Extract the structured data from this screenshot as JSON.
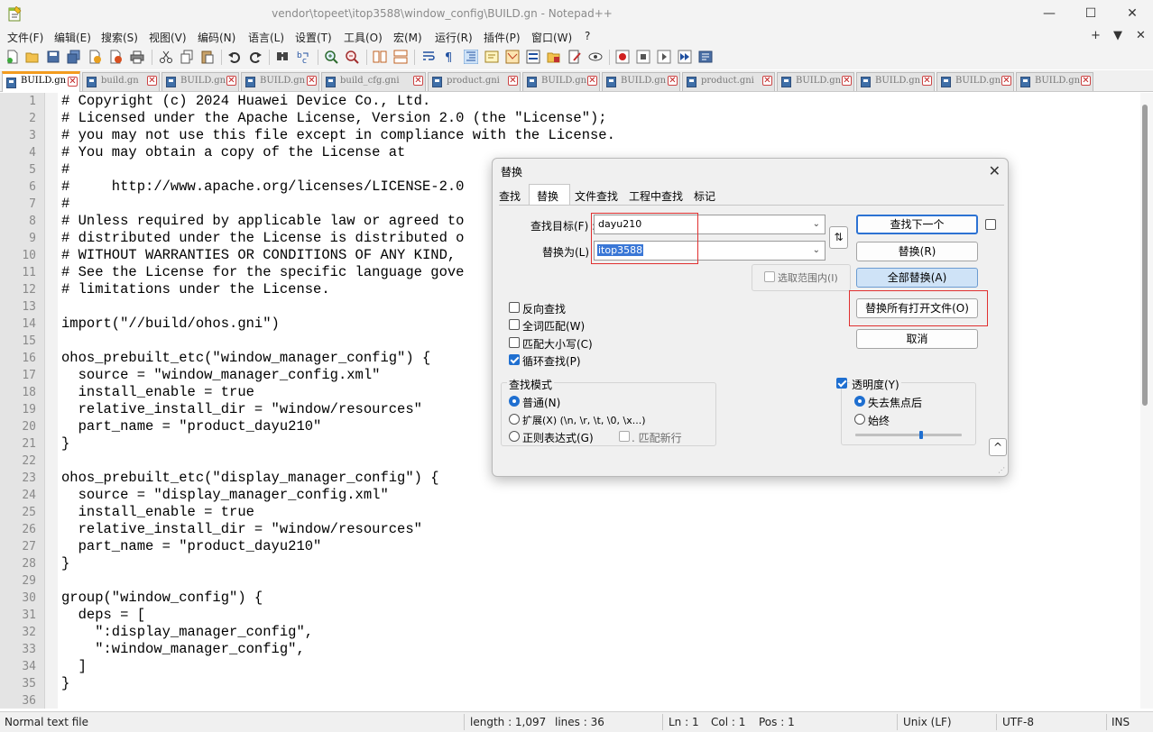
{
  "window": {
    "title": "vendor\\topeet\\itop3588\\window_config\\BUILD.gn - Notepad++",
    "minimize": "—",
    "maximize": "☐",
    "close": "✕"
  },
  "menu": {
    "items": [
      "文件(F)",
      "编辑(E)",
      "搜索(S)",
      "视图(V)",
      "编码(N)",
      "语言(L)",
      "设置(T)",
      "工具(O)",
      "宏(M)",
      "运行(R)",
      "插件(P)",
      "窗口(W)",
      "?"
    ],
    "right": [
      "+",
      "▼",
      "✕"
    ]
  },
  "toolbar": {
    "icons": [
      "new-file-icon",
      "open-file-icon",
      "save-icon",
      "save-all-icon",
      "close-icon",
      "close-all-icon",
      "print-icon",
      "cut-icon",
      "copy-icon",
      "paste-icon",
      "undo-icon",
      "redo-icon",
      "find-icon",
      "replace-icon",
      "zoom-in-icon",
      "zoom-out-icon",
      "sync-vertical-icon",
      "sync-horizontal-icon",
      "word-wrap-icon",
      "show-all-chars-icon",
      "indent-guide-icon",
      "language-icon",
      "doc-map-icon",
      "function-list-icon",
      "folder-workspace-icon",
      "monitor-icon",
      "record-macro-icon",
      "stop-record-icon",
      "play-macro-icon",
      "run-macro-multiple-icon",
      "save-macro-icon"
    ]
  },
  "tabs": [
    {
      "label": "BUILD.gn",
      "active": true
    },
    {
      "label": "build.gn",
      "active": false
    },
    {
      "label": "BUILD.gn",
      "active": false
    },
    {
      "label": "BUILD.gn",
      "active": false
    },
    {
      "label": "build_cfg.gni",
      "active": false
    },
    {
      "label": "product.gni",
      "active": false
    },
    {
      "label": "BUILD.gn",
      "active": false
    },
    {
      "label": "BUILD.gn",
      "active": false
    },
    {
      "label": "product.gni",
      "active": false
    },
    {
      "label": "BUILD.gn",
      "active": false
    },
    {
      "label": "BUILD.gn",
      "active": false
    },
    {
      "label": "BUILD.gn",
      "active": false
    },
    {
      "label": "BUILD.gn",
      "active": false
    }
  ],
  "editor": {
    "lines": [
      "# Copyright (c) 2024 Huawei Device Co., Ltd.",
      "# Licensed under the Apache License, Version 2.0 (the \"License\");",
      "# you may not use this file except in compliance with the License.",
      "# You may obtain a copy of the License at",
      "#",
      "#     http://www.apache.org/licenses/LICENSE-2.0",
      "#",
      "# Unless required by applicable law or agreed to",
      "# distributed under the License is distributed o",
      "# WITHOUT WARRANTIES OR CONDITIONS OF ANY KIND,",
      "# See the License for the specific language gove",
      "# limitations under the License.",
      "",
      "import(\"//build/ohos.gni\")",
      "",
      "ohos_prebuilt_etc(\"window_manager_config\") {",
      "  source = \"window_manager_config.xml\"",
      "  install_enable = true",
      "  relative_install_dir = \"window/resources\"",
      "  part_name = \"product_dayu210\"",
      "}",
      "",
      "ohos_prebuilt_etc(\"display_manager_config\") {",
      "  source = \"display_manager_config.xml\"",
      "  install_enable = true",
      "  relative_install_dir = \"window/resources\"",
      "  part_name = \"product_dayu210\"",
      "}",
      "",
      "group(\"window_config\") {",
      "  deps = [",
      "    \":display_manager_config\",",
      "    \":window_manager_config\",",
      "  ]",
      "}",
      ""
    ]
  },
  "status": {
    "type": "Normal text file",
    "length": "length : 1,097",
    "lines": "lines : 36",
    "ln": "Ln : 1",
    "col": "Col : 1",
    "pos": "Pos : 1",
    "eol": "Unix (LF)",
    "encoding": "UTF-8",
    "mode": "INS"
  },
  "dialog": {
    "title": "替换",
    "close": "✕",
    "tabs": [
      "查找",
      "替换",
      "文件查找",
      "工程中查找",
      "标记"
    ],
    "find_label": "查找目标(F) :",
    "find_value": "dayu210",
    "replace_label": "替换为(L) :",
    "replace_value": "itop3588",
    "swap_icon": "⇅",
    "in_selection": "选取范围内(I)",
    "buttons": {
      "find_next": "查找下一个",
      "replace": "替换(R)",
      "replace_all": "全部替换(A)",
      "replace_all_open": "替换所有打开文件(O)",
      "cancel": "取消"
    },
    "options": [
      {
        "label": "反向查找",
        "checked": false
      },
      {
        "label": "全词匹配(W)",
        "checked": false
      },
      {
        "label": "匹配大小写(C)",
        "checked": false
      },
      {
        "label": "循环查找(P)",
        "checked": true
      }
    ],
    "search_mode": {
      "title": "查找模式",
      "normal": "普通(N)",
      "extended": "扩展(X) (\\n, \\r, \\t, \\0, \\x...)",
      "regex": "正则表达式(G)",
      "dot_newline": ". 匹配新行"
    },
    "transparency": {
      "title": "透明度(Y)",
      "checked": true,
      "on_lose_focus": "失去焦点后",
      "always": "始终",
      "level": 0.6
    },
    "collapse_icon": "^"
  },
  "colors": {
    "accent": "#f39c1f",
    "selection": "#3a77d6",
    "highlight_box": "#e03030",
    "caret_line": "#e8e8ff"
  }
}
